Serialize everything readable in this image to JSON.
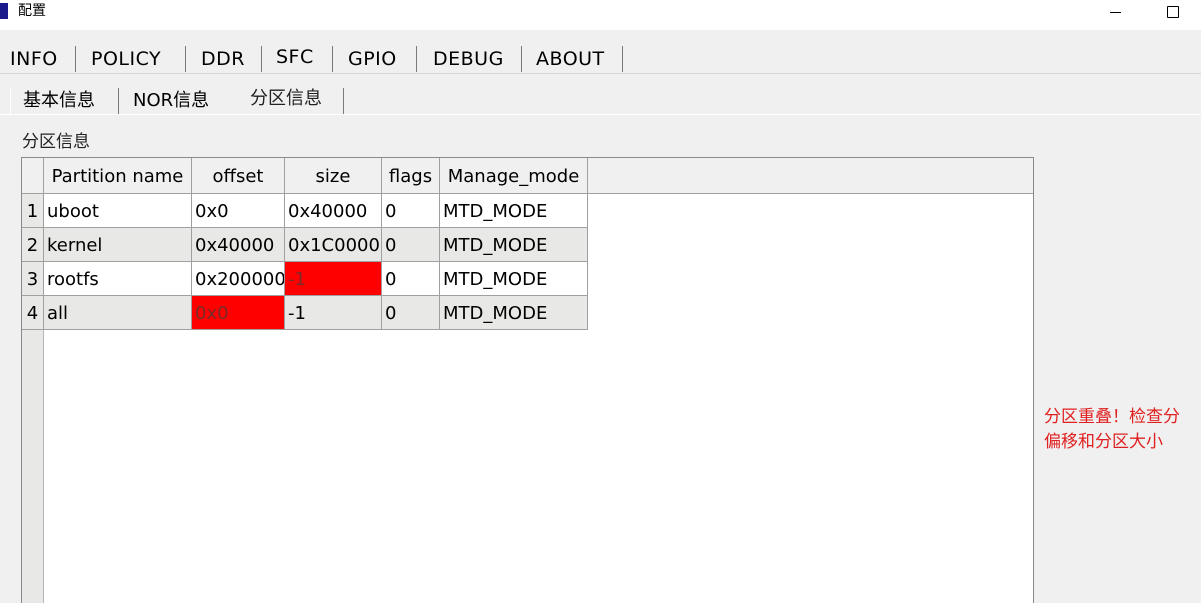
{
  "window": {
    "title": "配置"
  },
  "main_tabs": [
    {
      "label": "INFO",
      "active": false
    },
    {
      "label": "POLICY",
      "active": false
    },
    {
      "label": "DDR",
      "active": false
    },
    {
      "label": "SFC",
      "active": true
    },
    {
      "label": "GPIO",
      "active": false
    },
    {
      "label": "DEBUG",
      "active": false
    },
    {
      "label": "ABOUT",
      "active": false
    }
  ],
  "sub_tabs": [
    {
      "label": "基本信息",
      "active": false
    },
    {
      "label": "NOR信息",
      "active": false
    },
    {
      "label": "分区信息",
      "active": true
    }
  ],
  "group": {
    "title": "分区信息"
  },
  "table": {
    "headers": [
      "Partition name",
      "offset",
      "size",
      "flags",
      "Manage_mode"
    ],
    "rows": [
      {
        "num": "1",
        "cells": [
          "uboot",
          "0x0",
          "0x40000",
          "0",
          "MTD_MODE"
        ],
        "error_cols": []
      },
      {
        "num": "2",
        "cells": [
          "kernel",
          "0x40000",
          "0x1C00000",
          "0",
          "MTD_MODE"
        ],
        "error_cols": []
      },
      {
        "num": "3",
        "cells": [
          "rootfs",
          "0x200000",
          "-1",
          "0",
          "MTD_MODE"
        ],
        "error_cols": [
          2
        ]
      },
      {
        "num": "4",
        "cells": [
          "all",
          "0x0",
          "-1",
          "0",
          "MTD_MODE"
        ],
        "error_cols": [
          1
        ]
      }
    ]
  },
  "warning": {
    "line1": "分区重叠！检查分",
    "line2": "偏移和分区大小",
    "color": "#e02020"
  },
  "colors": {
    "error_cell": "#ff0000",
    "alt_row": "#e8e8e6",
    "title_icon": "#1a1a8c"
  }
}
